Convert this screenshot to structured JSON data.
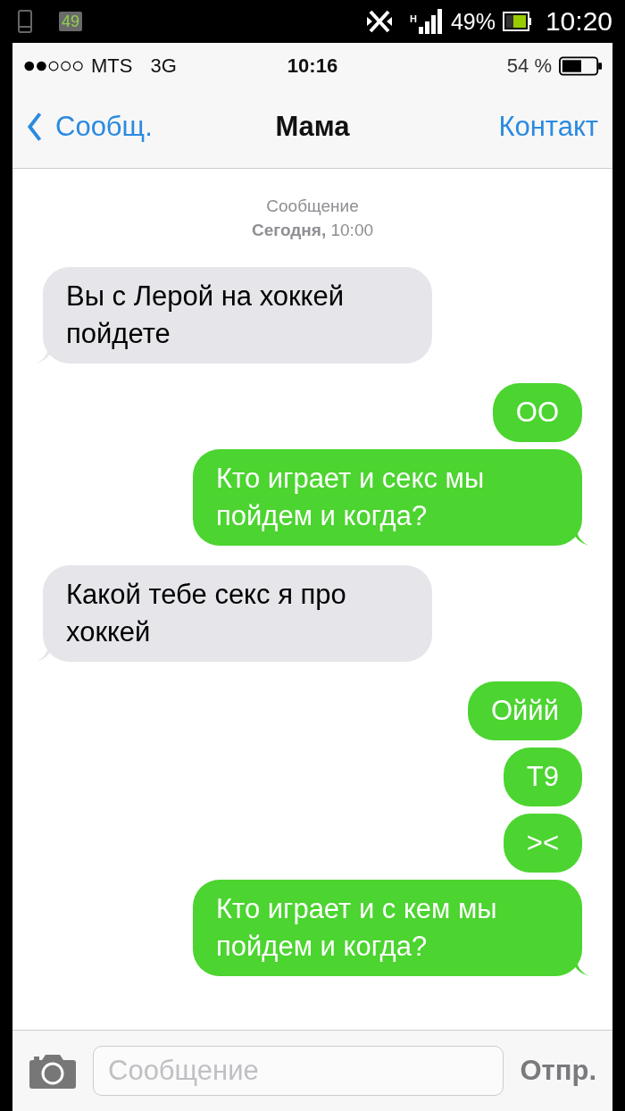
{
  "android_status_bar": {
    "battery_badge": "49",
    "network_type": "H",
    "battery_percent": "49%",
    "time": "10:20"
  },
  "ios_status_bar": {
    "carrier": "MTS",
    "network": "3G",
    "time": "10:16",
    "battery_percent": "54 %"
  },
  "nav_bar": {
    "back": "Сообщ.",
    "title": "Мама",
    "action": "Контакт"
  },
  "thread_header": {
    "service": "Сообщение",
    "date": "**Сегодня,** 10:00"
  },
  "messages": [
    {
      "kind": "incoming",
      "text": "Вы с Лерой на хоккей пойдете",
      "tail": true
    },
    {
      "kind": "outgoing",
      "text": "ОО",
      "tail": false
    },
    {
      "kind": "outgoing",
      "text": "Кто играет и секс мы пойдем и когда?",
      "tail": true
    },
    {
      "kind": "incoming",
      "text": "Какой тебе секс я про хоккей",
      "tail": true
    },
    {
      "kind": "outgoing",
      "text": "Оййй",
      "tail": false
    },
    {
      "kind": "outgoing",
      "text": "Т9",
      "tail": false
    },
    {
      "kind": "outgoing",
      "text": "><",
      "tail": false
    },
    {
      "kind": "outgoing",
      "text": "Кто играет и с кем мы пойдем и когда?",
      "tail": true
    }
  ],
  "input_bar": {
    "placeholder": "Сообщение",
    "send": "Отпр."
  }
}
